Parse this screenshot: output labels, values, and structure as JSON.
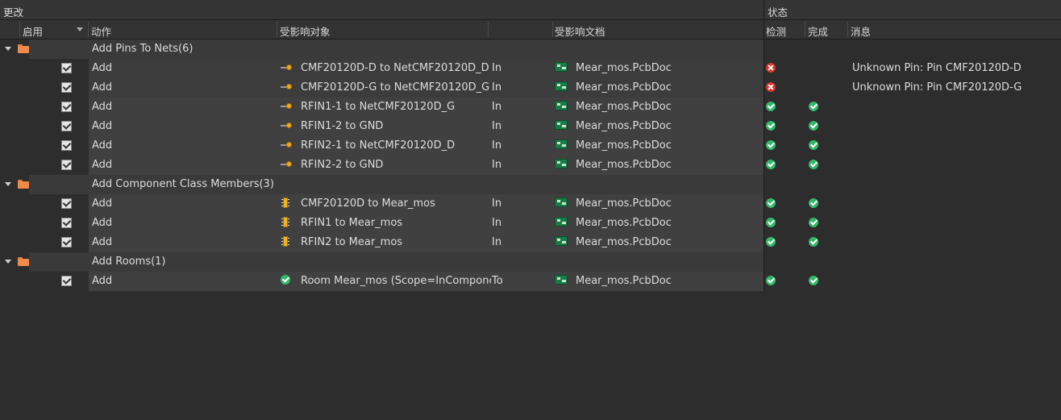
{
  "headers": {
    "changes_group": "更改",
    "status_group": "状态",
    "enable": "启用",
    "action": "动作",
    "affected_object": "受影响对象",
    "affected_document": "受影响文档",
    "check": "检测",
    "done": "完成",
    "message": "消息"
  },
  "groups": [
    {
      "label": "Add Pins To Nets(6)",
      "items": [
        {
          "action": "Add",
          "object": "CMF20120D-D to NetCMF20120D_D",
          "dir": "In",
          "document": "Mear_mos.PcbDoc",
          "check": "error",
          "done": "",
          "message": "Unknown Pin: Pin CMF20120D-D",
          "icon": "pin-icon"
        },
        {
          "action": "Add",
          "object": "CMF20120D-G to NetCMF20120D_G",
          "dir": "In",
          "document": "Mear_mos.PcbDoc",
          "check": "error",
          "done": "",
          "message": "Unknown Pin: Pin CMF20120D-G",
          "icon": "pin-icon"
        },
        {
          "action": "Add",
          "object": "RFIN1-1 to NetCMF20120D_G",
          "dir": "In",
          "document": "Mear_mos.PcbDoc",
          "check": "ok",
          "done": "ok",
          "message": "",
          "icon": "pin-icon"
        },
        {
          "action": "Add",
          "object": "RFIN1-2 to GND",
          "dir": "In",
          "document": "Mear_mos.PcbDoc",
          "check": "ok",
          "done": "ok",
          "message": "",
          "icon": "pin-icon"
        },
        {
          "action": "Add",
          "object": "RFIN2-1 to NetCMF20120D_D",
          "dir": "In",
          "document": "Mear_mos.PcbDoc",
          "check": "ok",
          "done": "ok",
          "message": "",
          "icon": "pin-icon"
        },
        {
          "action": "Add",
          "object": "RFIN2-2 to GND",
          "dir": "In",
          "document": "Mear_mos.PcbDoc",
          "check": "ok",
          "done": "ok",
          "message": "",
          "icon": "pin-icon"
        }
      ]
    },
    {
      "label": "Add Component Class Members(3)",
      "items": [
        {
          "action": "Add",
          "object": "CMF20120D to Mear_mos",
          "dir": "In",
          "document": "Mear_mos.PcbDoc",
          "check": "ok",
          "done": "ok",
          "message": "",
          "icon": "component-icon"
        },
        {
          "action": "Add",
          "object": "RFIN1 to Mear_mos",
          "dir": "In",
          "document": "Mear_mos.PcbDoc",
          "check": "ok",
          "done": "ok",
          "message": "",
          "icon": "component-icon"
        },
        {
          "action": "Add",
          "object": "RFIN2 to Mear_mos",
          "dir": "In",
          "document": "Mear_mos.PcbDoc",
          "check": "ok",
          "done": "ok",
          "message": "",
          "icon": "component-icon"
        }
      ]
    },
    {
      "label": "Add Rooms(1)",
      "items": [
        {
          "action": "Add",
          "object": "Room Mear_mos (Scope=InComponer",
          "dir": "To",
          "document": "Mear_mos.PcbDoc",
          "check": "ok",
          "done": "ok",
          "message": "",
          "icon": "room-icon"
        }
      ]
    }
  ]
}
